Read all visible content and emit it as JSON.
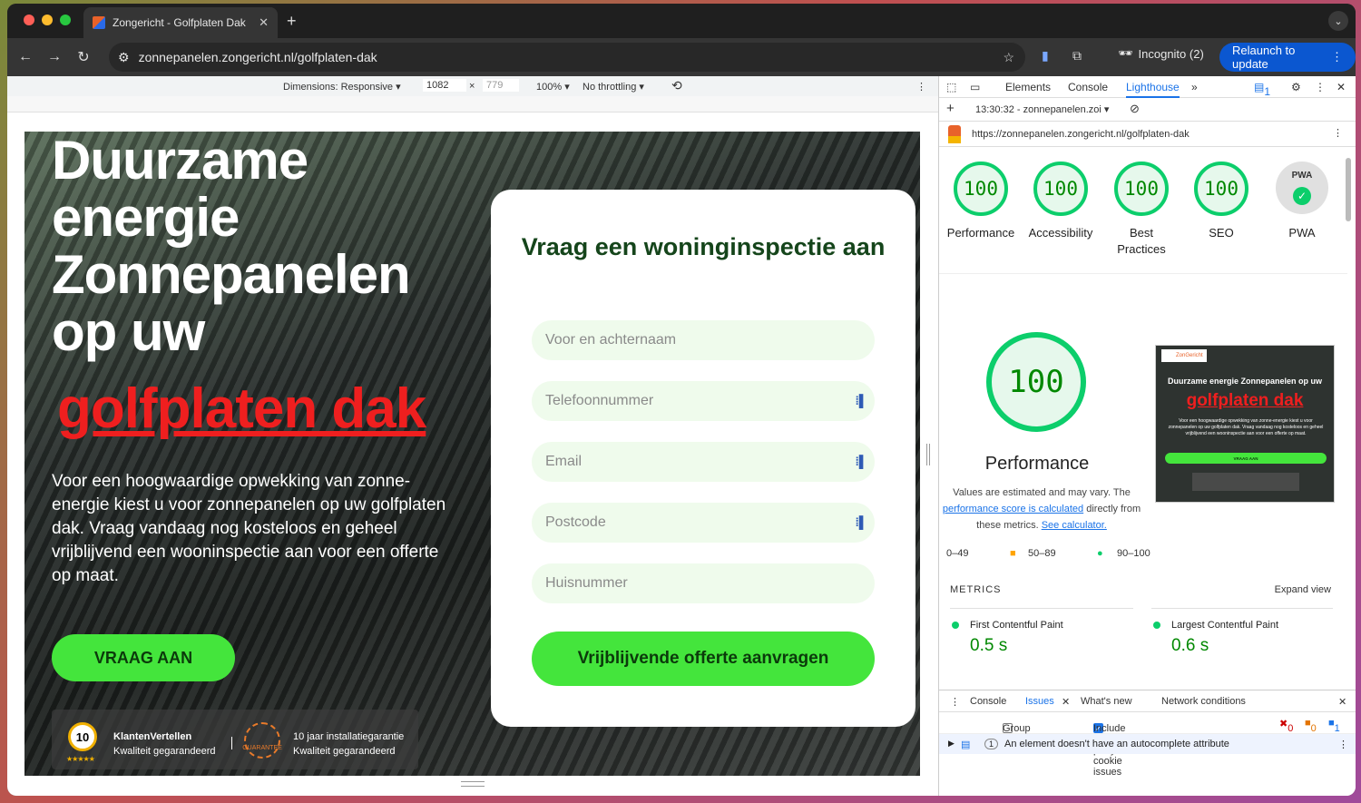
{
  "browser": {
    "tab_title": "Zongericht - Golfplaten Dak",
    "url": "zonnepanelen.zongericht.nl/golfplaten-dak",
    "incognito_label": "Incognito (2)",
    "relaunch_label": "Relaunch to update"
  },
  "devbar": {
    "dimensions_label": "Dimensions: Responsive ▾",
    "width": "1082",
    "x_sep": "×",
    "height": "779",
    "zoom": "100% ▾",
    "throttle": "No throttling ▾"
  },
  "page": {
    "hero_title": "Duurzame energie Zonnepanelen op uw",
    "hero_highlight": "golfplaten dak",
    "hero_text": "Voor een hoogwaardige opwekking van zonne-energie kiest u voor zonnepanelen op uw golfplaten dak. Vraag vandaag nog kosteloos en geheel vrijblijvend een wooninspectie aan voor een offerte op maat.",
    "cta_button": "VRAAG AAN",
    "badge1_score": "10",
    "badge1_stars": "★★★★★",
    "badge1_line1": "KlantenVertellen",
    "badge1_line2": "Kwaliteit gegarandeerd",
    "badge2_icon_text": "GUARANTEE",
    "badge2_line1": "10 jaar installatiegarantie",
    "badge2_line2": "Kwaliteit gegarandeerd",
    "form": {
      "title": "Vraag een woninginspectie aan",
      "fields": [
        {
          "placeholder": "Voor en achternaam"
        },
        {
          "placeholder": "Telefoonnummer"
        },
        {
          "placeholder": "Email"
        },
        {
          "placeholder": "Postcode"
        },
        {
          "placeholder": "Huisnummer"
        }
      ],
      "submit": "Vrijblijvende offerte aanvragen"
    }
  },
  "devtools": {
    "tabs": [
      "Elements",
      "Console",
      "Lighthouse"
    ],
    "active_tab": "Lighthouse",
    "issues_count": "1",
    "report_time": "13:30:32 - zonnepanelen.zoi ▾",
    "report_url": "https://zonnepanelen.zongericht.nl/golfplaten-dak",
    "gauges": [
      {
        "score": "100",
        "label": "Performance"
      },
      {
        "score": "100",
        "label": "Accessibility"
      },
      {
        "score": "100",
        "label": "Best Practices"
      },
      {
        "score": "100",
        "label": "SEO"
      }
    ],
    "pwa_badge": "PWA",
    "pwa_label": "PWA",
    "perf_score": "100",
    "perf_title": "Performance",
    "perf_note_1": "Values are estimated and may vary. The",
    "perf_note_link": "performance score is calculated",
    "perf_note_2": "directly from these metrics.",
    "perf_note_calc": "See calculator.",
    "thumb": {
      "logo": "ZonGericht",
      "title": "Duurzame energie Zonnepanelen op uw",
      "highlight": "golfplaten dak",
      "text": "Voor een hoogwaardige opwekking van zonne-energie kiest u voor zonnepanelen op uw golfplaten dak. Vraag vandaag nog kosteloos en geheel vrijblijvend een wooninspectie aan voor een offerte op maat.",
      "button": "VRAAG AAN"
    },
    "legend": [
      "0–49",
      "50–89",
      "90–100"
    ],
    "metrics_header": "METRICS",
    "expand_view": "Expand view",
    "metrics": [
      {
        "name": "First Contentful Paint",
        "value": "0.5 s"
      },
      {
        "name": "Largest Contentful Paint",
        "value": "0.6 s"
      }
    ],
    "drawer_tabs": [
      "Console",
      "Issues",
      "What's new",
      "Network conditions"
    ],
    "group_by_kind": "Group by kind",
    "include_third_party": "Include third-party cookie issues",
    "issue_counts": {
      "errors": "0",
      "warnings": "0",
      "info": "1"
    },
    "issue_badge": "1",
    "issue_text": "An element doesn't have an autocomplete attribute"
  },
  "colors": {
    "accent_green": "#44e53c",
    "highlight_red": "#ef1f1f",
    "lighthouse_green": "#0cce6b",
    "devtools_blue": "#1a73e8"
  }
}
